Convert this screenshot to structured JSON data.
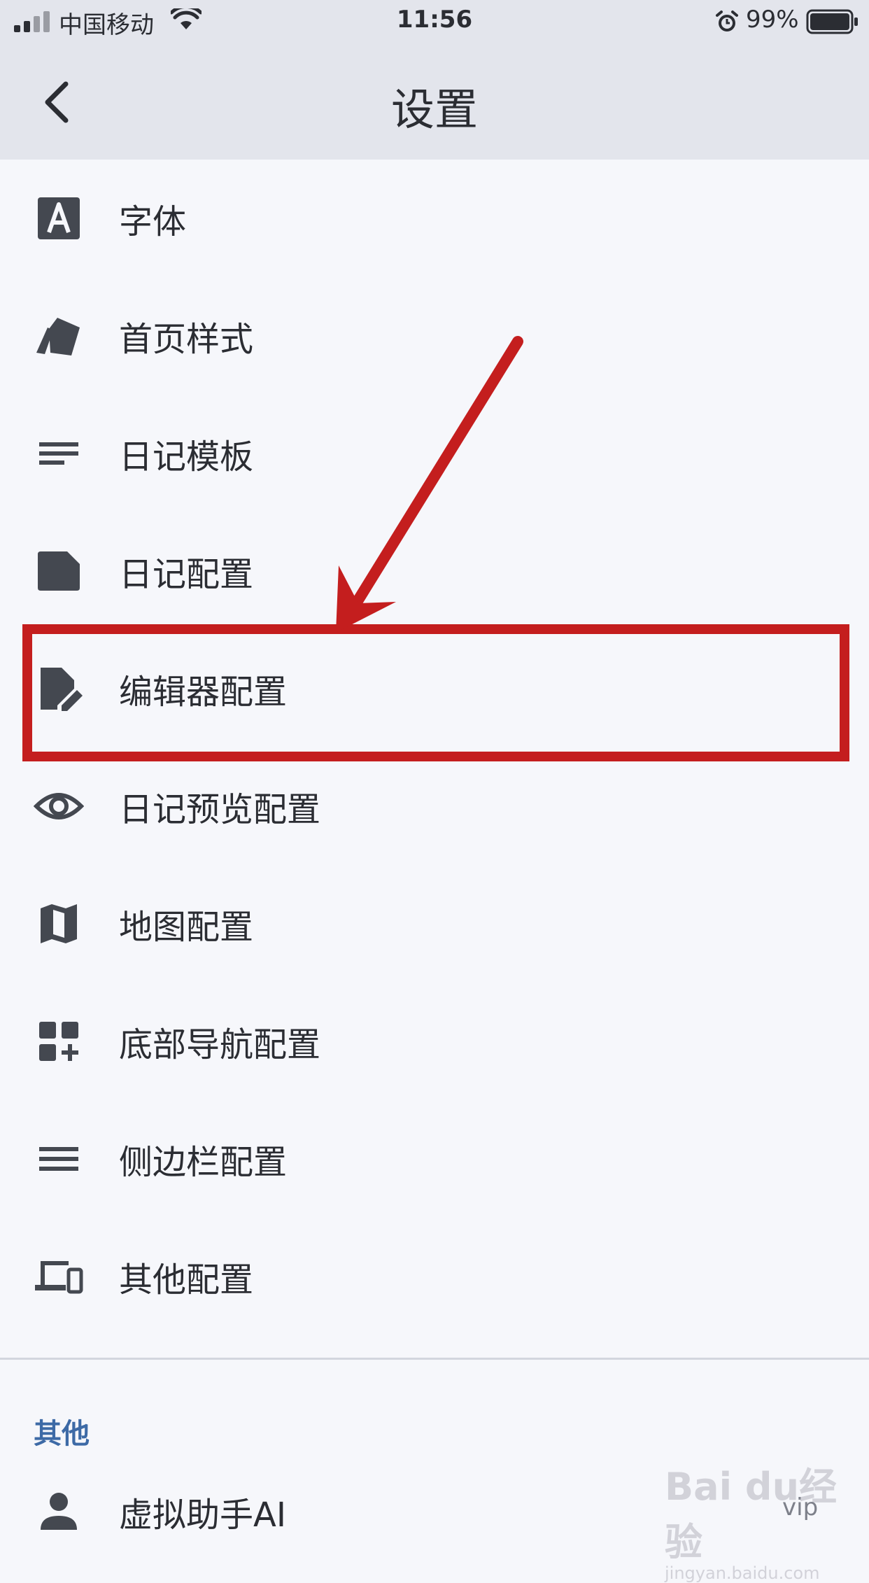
{
  "status": {
    "carrier": "中国移动",
    "time": "11:56",
    "battery": "99%"
  },
  "nav": {
    "title": "设置"
  },
  "items": [
    {
      "label": "字体",
      "icon": "font-icon"
    },
    {
      "label": "首页样式",
      "icon": "cards-icon"
    },
    {
      "label": "日记模板",
      "icon": "template-lines-icon"
    },
    {
      "label": "日记配置",
      "icon": "document-icon"
    },
    {
      "label": "编辑器配置",
      "icon": "edit-document-icon"
    },
    {
      "label": "日记预览配置",
      "icon": "eye-icon"
    },
    {
      "label": "地图配置",
      "icon": "map-icon"
    },
    {
      "label": "底部导航配置",
      "icon": "grid-add-icon"
    },
    {
      "label": "侧边栏配置",
      "icon": "menu-icon"
    },
    {
      "label": "其他配置",
      "icon": "devices-icon"
    }
  ],
  "section": {
    "title": "其他",
    "items": [
      {
        "label": "虚拟助手AI",
        "icon": "person-icon"
      }
    ]
  },
  "watermark": {
    "logo": "Bai du经验",
    "url": "jingyan.baidu.com"
  },
  "badge": "vip",
  "colors": {
    "highlight": "#c41e1e",
    "section_title": "#3d6aa6",
    "nav_bg": "#e3e5ec",
    "page_bg": "#f6f7fb"
  }
}
